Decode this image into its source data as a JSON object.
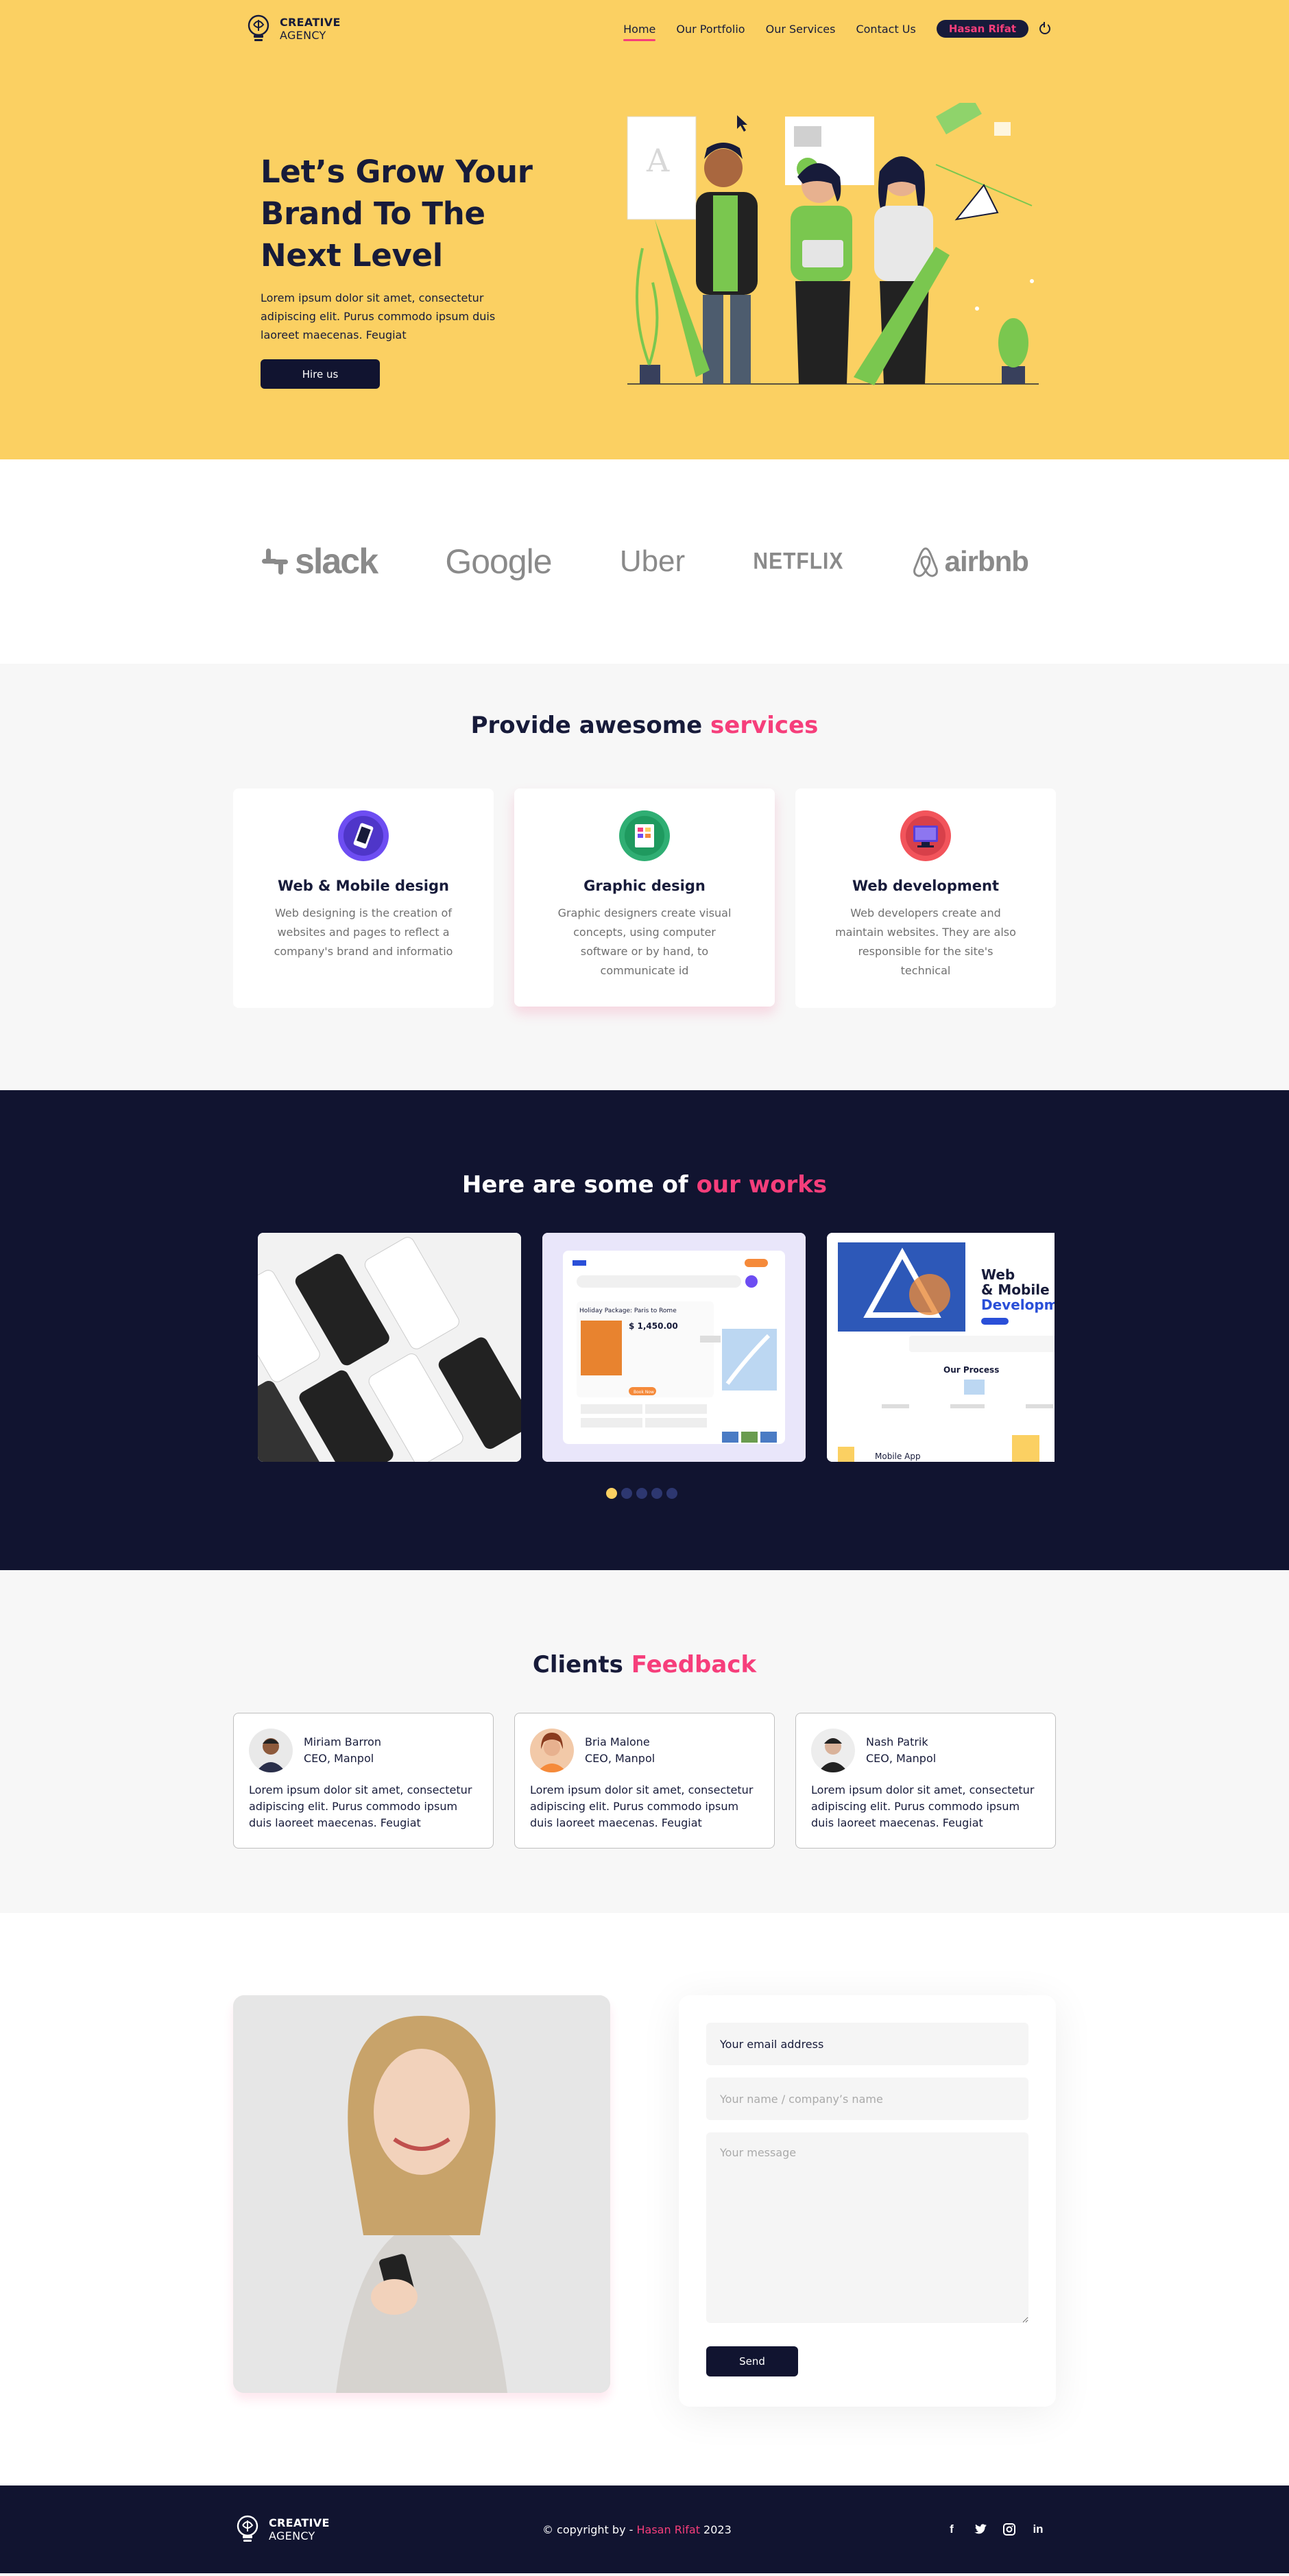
{
  "brand": {
    "name": "CREATIVE",
    "sub": "AGENCY"
  },
  "nav": {
    "items": [
      "Home",
      "Our Portfolio",
      "Our Services",
      "Contact Us"
    ],
    "user": "Hasan Rifat"
  },
  "hero": {
    "title": "Let’s Grow Your\nBrand To The\nNext Level",
    "description": "Lorem ipsum dolor sit amet, consectetur adipiscing elit. Purus commodo ipsum duis laoreet maecenas. Feugiat",
    "button": "Hire us"
  },
  "brands": [
    "slack",
    "Google",
    "Uber",
    "NETFLIX",
    "airbnb"
  ],
  "services": {
    "title_main": "Provide awesome ",
    "title_accent": "services",
    "items": [
      {
        "title": "Web & Mobile design",
        "desc": "Web designing is the creation of websites and pages to reflect a company's brand and informatio"
      },
      {
        "title": "Graphic design",
        "desc": "Graphic designers create visual concepts, using computer software or by hand, to communicate id"
      },
      {
        "title": "Web development",
        "desc": "Web developers create and maintain websites. They are also responsible for the site's technical"
      }
    ]
  },
  "works": {
    "title_main": "Here are some of ",
    "title_accent": "our works",
    "slide2": {
      "title": "Holiday Package: Paris to Rome",
      "price": "$ 1,450.00",
      "btn": "Book Now"
    },
    "slide3": {
      "headline1": "Web",
      "headline2": "& Mobile",
      "headline3": "Developme",
      "process": "Our Process",
      "footer": "Mobile App"
    },
    "dots": 5
  },
  "feedback": {
    "title_main": "Clients ",
    "title_accent": "Feedback",
    "items": [
      {
        "name": "Miriam Barron",
        "role": "CEO, Manpol",
        "text": "Lorem ipsum dolor sit amet, consectetur adipiscing elit. Purus commodo ipsum duis laoreet maecenas. Feugiat"
      },
      {
        "name": "Bria Malone",
        "role": "CEO, Manpol",
        "text": "Lorem ipsum dolor sit amet, consectetur adipiscing elit. Purus commodo ipsum duis laoreet maecenas. Feugiat"
      },
      {
        "name": "Nash Patrik",
        "role": "CEO, Manpol",
        "text": "Lorem ipsum dolor sit amet, consectetur adipiscing elit. Purus commodo ipsum duis laoreet maecenas. Feugiat"
      }
    ]
  },
  "contact": {
    "email_placeholder": "Your email address",
    "name_placeholder": "Your name / company’s name",
    "message_placeholder": "Your message",
    "send": "Send"
  },
  "footer": {
    "copy_prefix": "© copyright by - ",
    "copy_name": "Hasan Rifat",
    "copy_year": " 2023",
    "social": [
      "facebook-icon",
      "twitter-icon",
      "instagram-icon",
      "linkedin-icon"
    ]
  },
  "colors": {
    "yellow": "#FBD062",
    "navy": "#111430",
    "pink": "#F63E7B",
    "light": "#F7F7F7"
  }
}
